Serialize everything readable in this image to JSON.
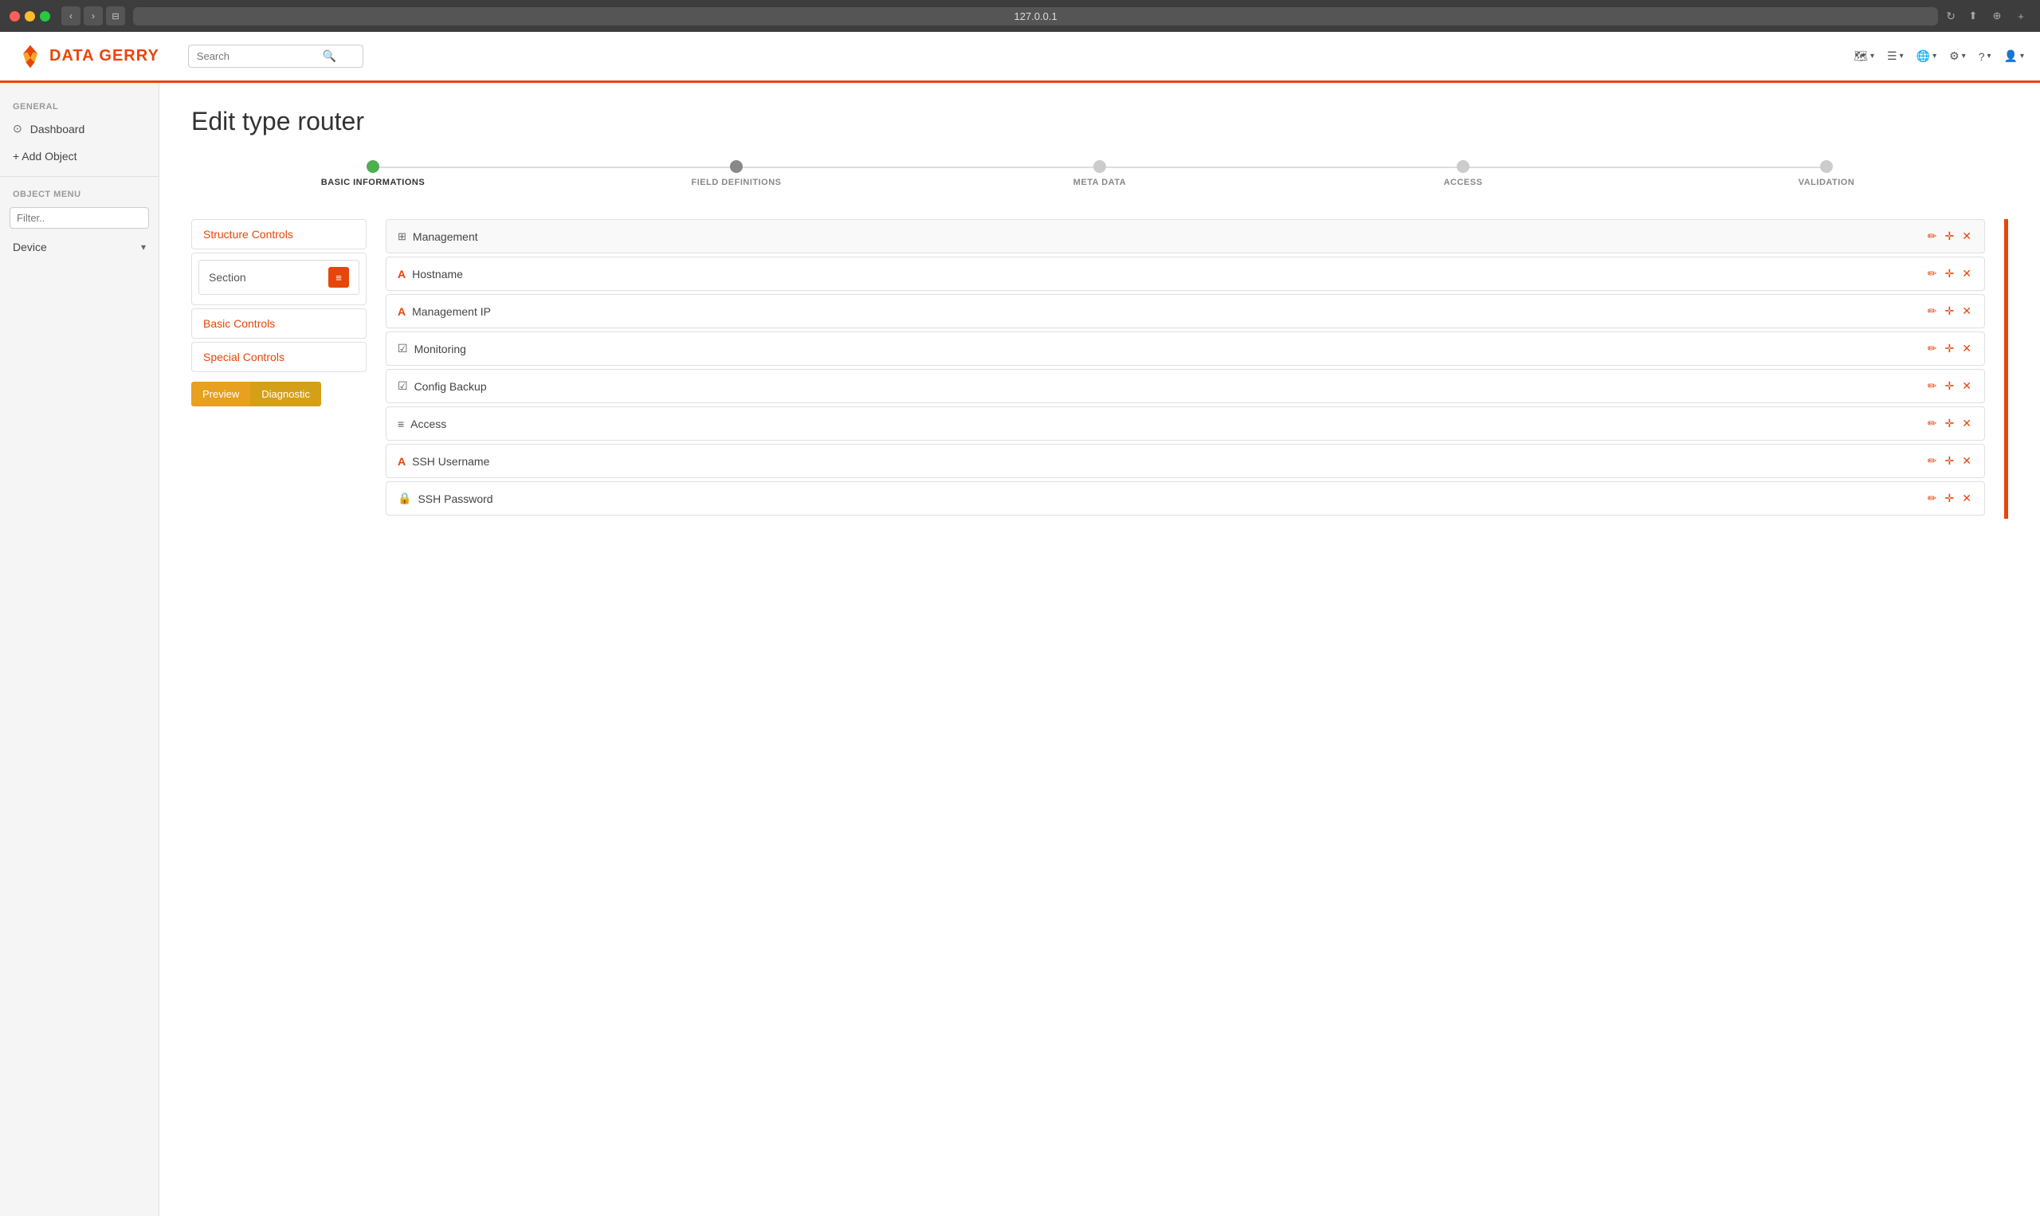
{
  "browser": {
    "address": "127.0.0.1",
    "nav_back": "‹",
    "nav_forward": "›"
  },
  "header": {
    "logo_text_data": "DATA",
    "logo_text_gerry": "GERRY",
    "search_placeholder": "Search",
    "actions": [
      {
        "id": "map",
        "icon": "🗺",
        "label": ""
      },
      {
        "id": "layers",
        "icon": "☰",
        "label": ""
      },
      {
        "id": "translate",
        "icon": "🌐",
        "label": ""
      },
      {
        "id": "settings",
        "icon": "⚙",
        "label": ""
      },
      {
        "id": "help",
        "icon": "?",
        "label": ""
      },
      {
        "id": "user",
        "icon": "👤",
        "label": ""
      }
    ]
  },
  "sidebar": {
    "general_label": "GENERAL",
    "dashboard_label": "Dashboard",
    "add_object_label": "+ Add Object",
    "object_menu_label": "OBJECT MENU",
    "filter_placeholder": "Filter..",
    "device_label": "Device"
  },
  "main": {
    "page_title": "Edit type router",
    "wizard_steps": [
      {
        "id": "basic",
        "label": "BASIC INFORMATIONS",
        "state": "active"
      },
      {
        "id": "fields",
        "label": "FIELD DEFINITIONS",
        "state": "semi-active"
      },
      {
        "id": "meta",
        "label": "META DATA",
        "state": "inactive"
      },
      {
        "id": "access",
        "label": "ACCESS",
        "state": "inactive"
      },
      {
        "id": "validation",
        "label": "VALIDATION",
        "state": "inactive"
      }
    ],
    "left_panel": {
      "sections": [
        {
          "id": "structure",
          "label": "Structure Controls",
          "type": "header-only"
        },
        {
          "id": "section-group",
          "items": [
            {
              "id": "section",
              "label": "Section",
              "icon": "≡"
            }
          ]
        },
        {
          "id": "basic",
          "label": "Basic Controls",
          "type": "header-only"
        },
        {
          "id": "special",
          "label": "Special Controls",
          "type": "header-only"
        }
      ],
      "preview_label": "Preview",
      "diagnostic_label": "Diagnostic"
    },
    "right_panel": {
      "field_group": {
        "title": "Management",
        "icon": "⊞"
      },
      "fields": [
        {
          "id": "hostname",
          "label": "Hostname",
          "icon": "A"
        },
        {
          "id": "management-ip",
          "label": "Management IP",
          "icon": "A"
        },
        {
          "id": "monitoring",
          "label": "Monitoring",
          "icon": "✔"
        },
        {
          "id": "config-backup",
          "label": "Config Backup",
          "icon": "✔"
        },
        {
          "id": "access",
          "label": "Access",
          "icon": "≡"
        },
        {
          "id": "ssh-username",
          "label": "SSH Username",
          "icon": "A"
        },
        {
          "id": "ssh-password",
          "label": "SSH Password",
          "icon": "🔒"
        }
      ]
    }
  }
}
